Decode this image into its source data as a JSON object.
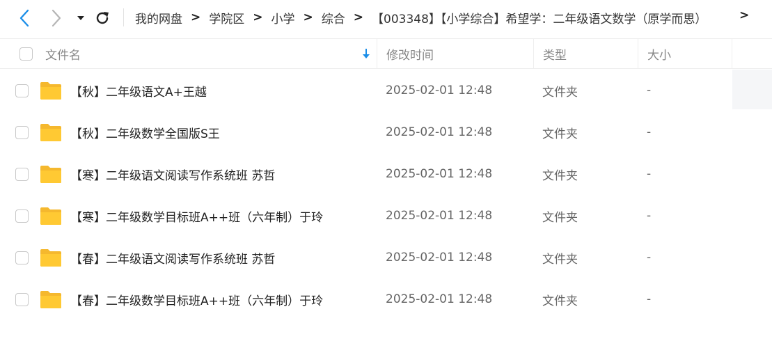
{
  "nav": {
    "back_icon": "chevron-left-icon",
    "forward_icon": "chevron-right-icon",
    "dropdown_icon": "caret-down-icon",
    "refresh_icon": "refresh-icon",
    "accent_color": "#1b8ee8"
  },
  "breadcrumb": {
    "items": [
      "我的网盘",
      "学院区",
      "小学",
      "综合",
      "【003348】【小学综合】希望学：二年级语文数学（原学而思）"
    ],
    "separator": ">",
    "more": ">"
  },
  "table": {
    "columns": {
      "name": "文件名",
      "modified": "修改时间",
      "type": "类型",
      "size": "大小"
    },
    "sort_icon": "sort-down-arrow-icon",
    "rows": [
      {
        "name": "【秋】二年级语文A+王越",
        "modified": "2025-02-01 12:48",
        "type": "文件夹",
        "size": "-"
      },
      {
        "name": "【秋】二年级数学全国版S王",
        "modified": "2025-02-01 12:48",
        "type": "文件夹",
        "size": "-"
      },
      {
        "name": "【寒】二年级语文阅读写作系统班 苏哲",
        "modified": "2025-02-01 12:48",
        "type": "文件夹",
        "size": "-"
      },
      {
        "name": "【寒】二年级数学目标班A++班（六年制）于玲",
        "modified": "2025-02-01 12:48",
        "type": "文件夹",
        "size": "-"
      },
      {
        "name": "【春】二年级语文阅读写作系统班 苏哲",
        "modified": "2025-02-01 12:48",
        "type": "文件夹",
        "size": "-"
      },
      {
        "name": "【春】二年级数学目标班A++班（六年制）于玲",
        "modified": "2025-02-01 12:48",
        "type": "文件夹",
        "size": "-"
      }
    ],
    "folder_icon": "folder-icon",
    "folder_color": "#ffc933"
  }
}
